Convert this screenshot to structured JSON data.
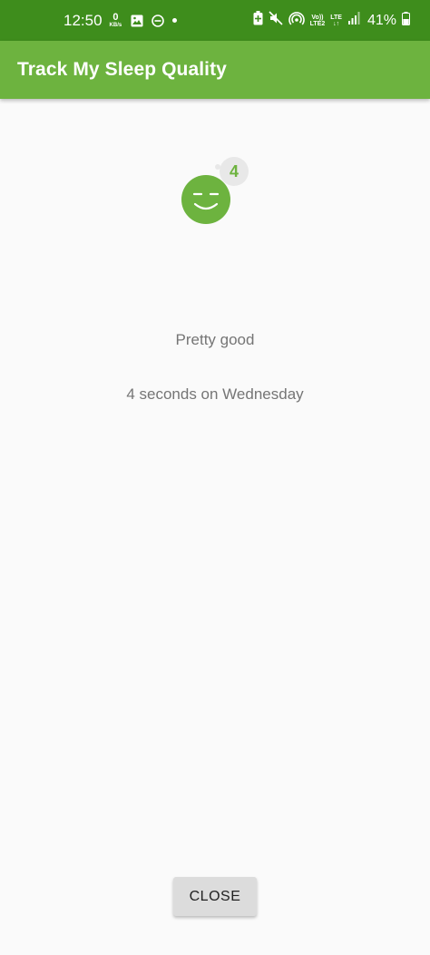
{
  "status_bar": {
    "time": "12:50",
    "net_speed_value": "0",
    "net_speed_unit": "KB/s",
    "icons": [
      "gallery-icon",
      "do-not-disturb-icon",
      "notification-dot-icon",
      "battery-saver-icon",
      "mute-icon",
      "hotspot-icon",
      "signal-icon"
    ],
    "volte": "Vo))",
    "lte2": "LTE2",
    "lte": "LTE",
    "battery": "41%"
  },
  "app_bar": {
    "title": "Track My Sleep Quality"
  },
  "detail": {
    "quality_icon": "sleep-quality-4-icon",
    "quality_number": "4",
    "quality_label": "Pretty good",
    "duration": "4 seconds on Wednesday"
  },
  "actions": {
    "close_label": "CLOSE"
  },
  "colors": {
    "status_bar": "#3e8d1c",
    "app_bar": "#6db33f",
    "accent": "#6db33f",
    "background": "#fafafa",
    "text_secondary": "#757575"
  }
}
